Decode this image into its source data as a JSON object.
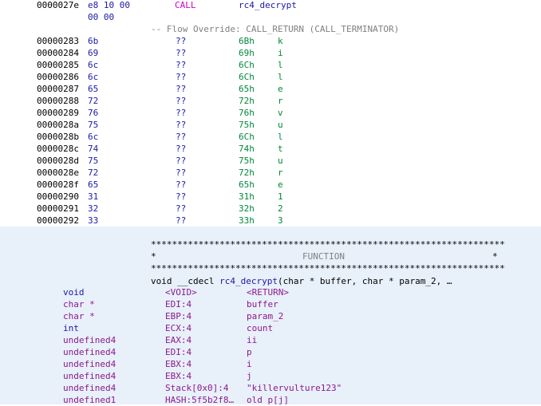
{
  "call_line": {
    "address": "0000027e",
    "bytes": "e8 10 00",
    "bytes_cont": "00 00",
    "mnemonic": "CALL",
    "operand": "rc4_decrypt"
  },
  "flow_override": "-- Flow Override: CALL_RETURN (CALL_TERMINATOR)",
  "data_rows": [
    {
      "addr": "00000283",
      "byte": "6b",
      "q": "??",
      "hex": "6Bh",
      "ch": "k"
    },
    {
      "addr": "00000284",
      "byte": "69",
      "q": "??",
      "hex": "69h",
      "ch": "i"
    },
    {
      "addr": "00000285",
      "byte": "6c",
      "q": "??",
      "hex": "6Ch",
      "ch": "l"
    },
    {
      "addr": "00000286",
      "byte": "6c",
      "q": "??",
      "hex": "6Ch",
      "ch": "l"
    },
    {
      "addr": "00000287",
      "byte": "65",
      "q": "??",
      "hex": "65h",
      "ch": "e"
    },
    {
      "addr": "00000288",
      "byte": "72",
      "q": "??",
      "hex": "72h",
      "ch": "r"
    },
    {
      "addr": "00000289",
      "byte": "76",
      "q": "??",
      "hex": "76h",
      "ch": "v"
    },
    {
      "addr": "0000028a",
      "byte": "75",
      "q": "??",
      "hex": "75h",
      "ch": "u"
    },
    {
      "addr": "0000028b",
      "byte": "6c",
      "q": "??",
      "hex": "6Ch",
      "ch": "l"
    },
    {
      "addr": "0000028c",
      "byte": "74",
      "q": "??",
      "hex": "74h",
      "ch": "t"
    },
    {
      "addr": "0000028d",
      "byte": "75",
      "q": "??",
      "hex": "75h",
      "ch": "u"
    },
    {
      "addr": "0000028e",
      "byte": "72",
      "q": "??",
      "hex": "72h",
      "ch": "r"
    },
    {
      "addr": "0000028f",
      "byte": "65",
      "q": "??",
      "hex": "65h",
      "ch": "e"
    },
    {
      "addr": "00000290",
      "byte": "31",
      "q": "??",
      "hex": "31h",
      "ch": "1"
    },
    {
      "addr": "00000291",
      "byte": "32",
      "q": "??",
      "hex": "32h",
      "ch": "2"
    },
    {
      "addr": "00000292",
      "byte": "33",
      "q": "??",
      "hex": "33h",
      "ch": "3"
    }
  ],
  "function_header": {
    "stars": "*******************************************************************",
    "label_left": "*",
    "label": "FUNCTION",
    "label_right": "*",
    "sig_pre": "void __cdecl ",
    "sig_name": "rc4_decrypt",
    "sig_post": "(char * buffer, char * param_2, …"
  },
  "params": [
    {
      "type": "void",
      "plain": true,
      "storage": "<VOID>",
      "name": "<RETURN>",
      "name_black": false
    },
    {
      "type": "char *",
      "plain": false,
      "storage": "EDI:4",
      "name": "buffer",
      "name_black": false
    },
    {
      "type": "char *",
      "plain": false,
      "storage": "EBP:4",
      "name": "param_2",
      "name_black": false
    },
    {
      "type": "int",
      "plain": true,
      "storage": "ECX:4",
      "name": "count",
      "name_black": false
    },
    {
      "type": "undefined4",
      "plain": false,
      "storage": "EAX:4",
      "name": "ii",
      "name_black": false
    },
    {
      "type": "undefined4",
      "plain": false,
      "storage": "EDI:4",
      "name": "p",
      "name_black": false
    },
    {
      "type": "undefined4",
      "plain": false,
      "storage": "EBX:4",
      "name": "i",
      "name_black": false
    },
    {
      "type": "undefined4",
      "plain": false,
      "storage": "EBX:4",
      "name": "j",
      "name_black": false
    },
    {
      "type": "undefined4",
      "plain": false,
      "storage": "Stack[0x0]:4",
      "name": "\"killervulture123\"",
      "name_black": false
    },
    {
      "type": "undefined1",
      "plain": false,
      "storage": "HASH:5f5b2f8…",
      "name": "old p[j]",
      "name_black": false
    }
  ],
  "colors": {
    "lower_background": "#e8f0fa",
    "address": "#000000",
    "bytes": "#1a1aa6",
    "mnemonic_call": "#cc00cc",
    "hex_value": "#00873b",
    "type": "#8b1a8b"
  }
}
